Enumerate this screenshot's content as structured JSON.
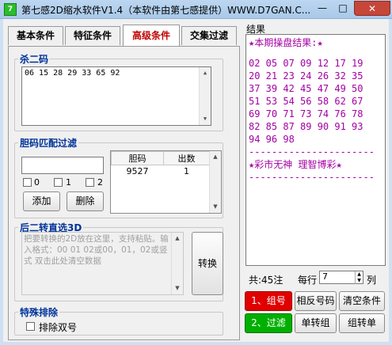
{
  "window": {
    "title": "第七感2D缩水软件V1.4（本软件由第七感提供）WWW.D7GAN.C...",
    "app_icon_text": "7",
    "minimize_icon": "minimize-icon",
    "maximize_icon": "maximize-icon",
    "close_icon": "close-icon"
  },
  "tabs": [
    {
      "label": "基本条件",
      "active": false
    },
    {
      "label": "特征条件",
      "active": false
    },
    {
      "label": "高级条件",
      "active": true
    },
    {
      "label": "交集过滤",
      "active": false
    }
  ],
  "kill_two": {
    "legend": "杀二码",
    "value": "06 15 28 29 33 65 92"
  },
  "courage_filter": {
    "legend": "胆码匹配过滤",
    "input_value": "",
    "checkboxes": [
      {
        "label": "0",
        "checked": false
      },
      {
        "label": "1",
        "checked": false
      },
      {
        "label": "2",
        "checked": false
      }
    ],
    "add_label": "添加",
    "delete_label": "删除",
    "columns": [
      "胆码",
      "出数"
    ],
    "rows": [
      {
        "code": "9527",
        "count": "1"
      }
    ]
  },
  "direct_3d": {
    "legend": "后二转直选3D",
    "placeholder": "把要转换的2D放在这里，支持粘贴。输入格式：00 01 02或00，01，02或竖式    双击此处清空数据",
    "convert_label": "转换"
  },
  "special_exclude": {
    "legend": "特殊排除",
    "checkbox_label": "排除双号",
    "checked": false
  },
  "result": {
    "label": "结果",
    "header": "★本期操盘结果:★",
    "numbers": "02 05 07 09 12 17 19\n20 21 23 24 26 32 35\n37 39 42 45 47 49 50\n51 53 54 56 58 62 67\n69 70 71 73 74 76 78\n82 85 87 89 90 91 93\n94 96 98",
    "divider": "----------------------",
    "footer": "★彩市无神 理智博彩★",
    "total": "共:45注",
    "per_row_label": "每行",
    "per_row_value": "7",
    "col_label": "列"
  },
  "actions": {
    "group_label": "1、组号",
    "reverse_label": "相反号码",
    "clear_label": "清空条件",
    "filter_label": "2、过滤",
    "single_to_group_label": "单转组",
    "group_to_single_label": "组转单"
  },
  "colors": {
    "accent_red": "#e00000",
    "accent_green": "#00b000",
    "result_purple": "#a400a4",
    "legend_blue": "#003399"
  }
}
